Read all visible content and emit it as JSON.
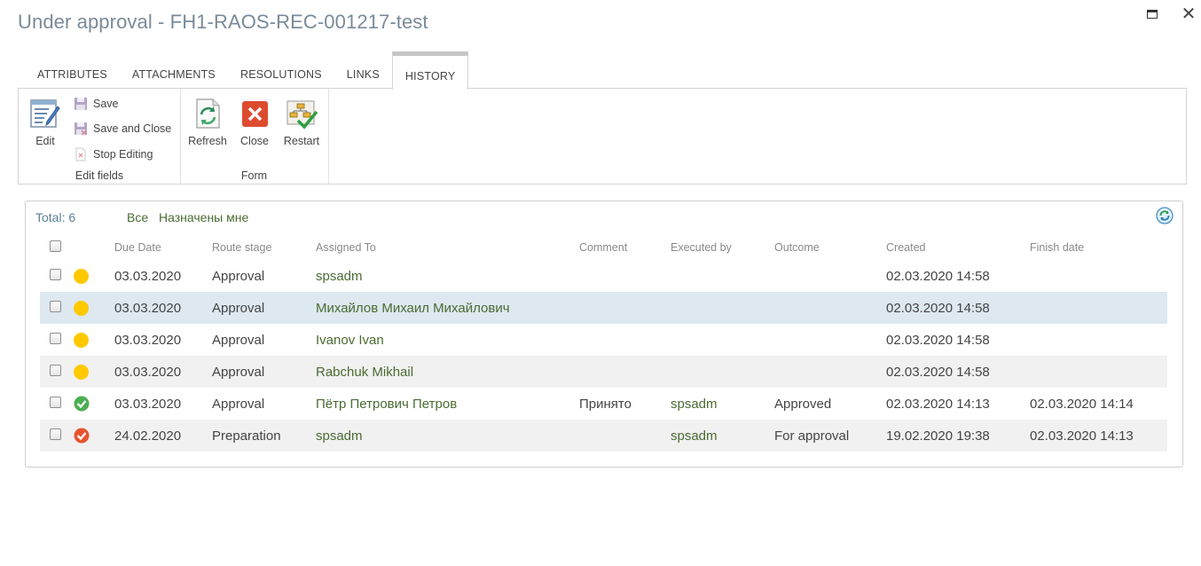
{
  "window": {
    "title": "Under approval - FH1-RAOS-REC-001217-test",
    "controls": [
      "maximize-icon",
      "close-icon"
    ]
  },
  "tabs": [
    {
      "label": "ATTRIBUTES",
      "active": false
    },
    {
      "label": "ATTACHMENTS",
      "active": false
    },
    {
      "label": "RESOLUTIONS",
      "active": false
    },
    {
      "label": "LINKS",
      "active": false
    },
    {
      "label": "HISTORY",
      "active": true
    }
  ],
  "ribbon": {
    "edit_fields": {
      "label": "Edit fields",
      "edit": "Edit",
      "save": "Save",
      "save_and_close": "Save and Close",
      "stop_editing": "Stop Editing"
    },
    "form": {
      "label": "Form",
      "refresh": "Refresh",
      "close": "Close",
      "restart": "Restart"
    }
  },
  "history": {
    "total": "Total: 6",
    "filters": [
      "Все",
      "Назначены мне"
    ],
    "columns": [
      "Due Date",
      "Route stage",
      "Assigned To",
      "Comment",
      "Executed by",
      "Outcome",
      "Created",
      "Finish date"
    ],
    "rows": [
      {
        "status": "pending",
        "due_date": "03.03.2020",
        "route_stage": "Approval",
        "assigned_to": "spsadm",
        "comment": "",
        "executed_by": "",
        "outcome": "",
        "created": "02.03.2020 14:58",
        "finish_date": ""
      },
      {
        "status": "pending",
        "due_date": "03.03.2020",
        "route_stage": "Approval",
        "assigned_to": "Михайлов Михаил Михайлович",
        "comment": "",
        "executed_by": "",
        "outcome": "",
        "created": "02.03.2020 14:58",
        "finish_date": ""
      },
      {
        "status": "pending",
        "due_date": "03.03.2020",
        "route_stage": "Approval",
        "assigned_to": "Ivanov Ivan",
        "comment": "",
        "executed_by": "",
        "outcome": "",
        "created": "02.03.2020 14:58",
        "finish_date": ""
      },
      {
        "status": "pending",
        "due_date": "03.03.2020",
        "route_stage": "Approval",
        "assigned_to": "Rabchuk Mikhail",
        "comment": "",
        "executed_by": "",
        "outcome": "",
        "created": "02.03.2020 14:58",
        "finish_date": ""
      },
      {
        "status": "approved",
        "due_date": "03.03.2020",
        "route_stage": "Approval",
        "assigned_to": "Пётр Петрович Петров",
        "comment": "Принято",
        "executed_by": "spsadm",
        "outcome": "Approved",
        "created": "02.03.2020 14:13",
        "finish_date": "02.03.2020 14:14"
      },
      {
        "status": "completed",
        "due_date": "24.02.2020",
        "route_stage": "Preparation",
        "assigned_to": "spsadm",
        "comment": "",
        "executed_by": "spsadm",
        "outcome": "For approval",
        "created": "19.02.2020 19:38",
        "finish_date": "02.03.2020 14:13"
      }
    ]
  },
  "colors": {
    "title": "#7a8a99",
    "link_green": "#4a6b32",
    "pending": "#ffc900",
    "approved": "#4caf50",
    "completed": "#e8542f",
    "selected_row": "#dde8f0"
  }
}
